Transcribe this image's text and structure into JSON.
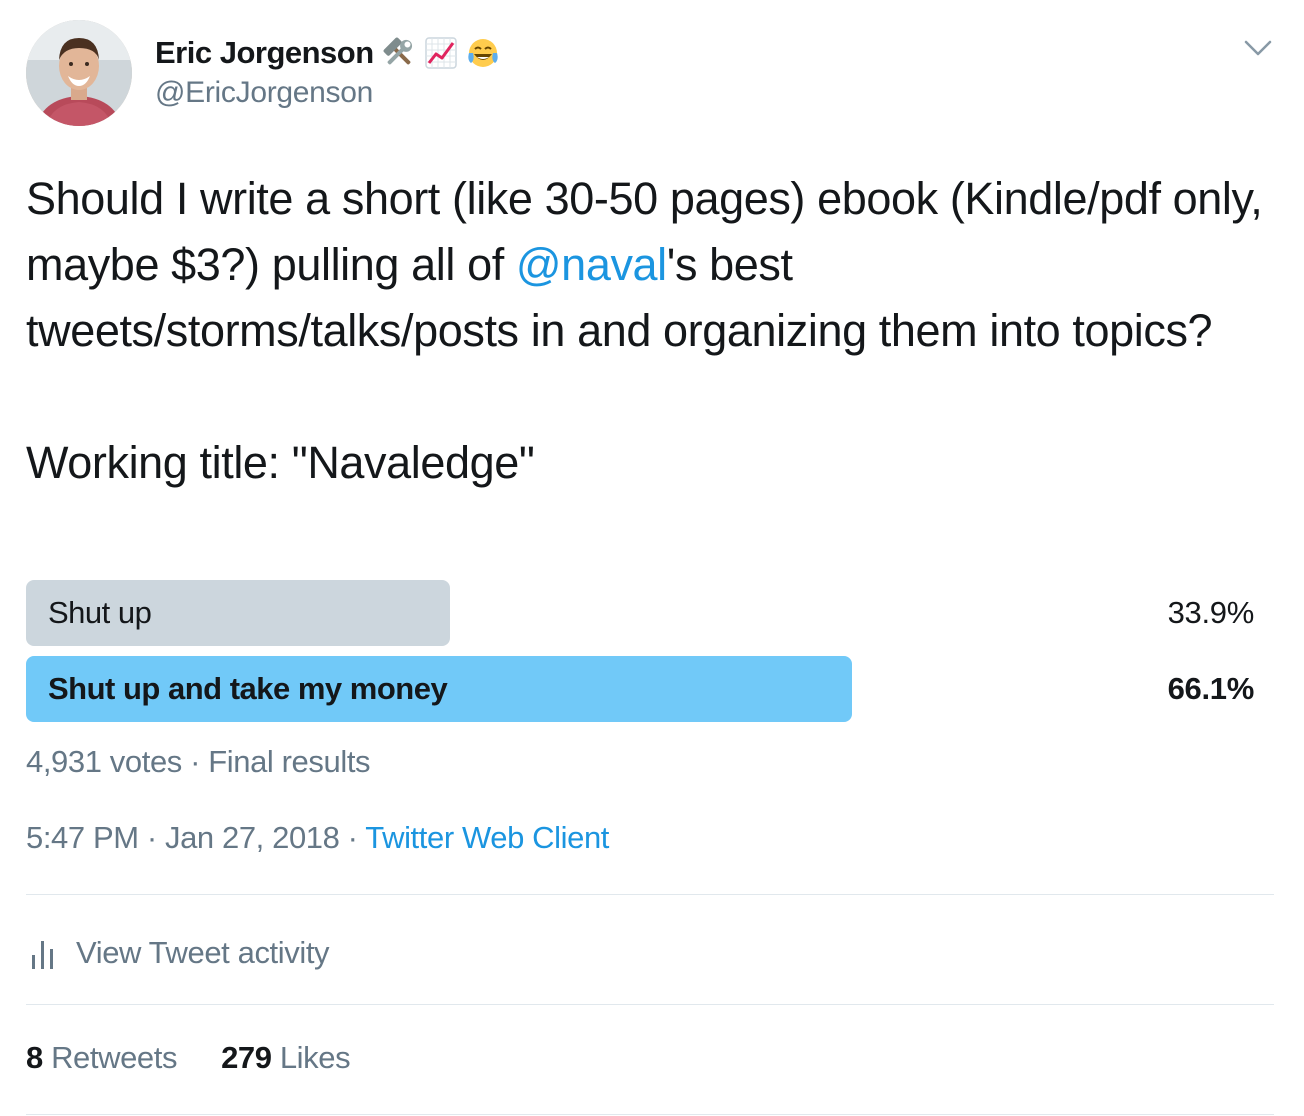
{
  "author": {
    "display_name": "Eric Jorgenson",
    "handle": "@EricJorgenson",
    "badge_icons": [
      "hammer-and-wrench-icon",
      "chart-increasing-icon",
      "face-with-tears-of-joy-icon"
    ]
  },
  "tweet": {
    "line1_before": "Should I write a short (like 30-50 pages) ebook (Kindle/pdf only, maybe $3?) pulling all of ",
    "mention": "@naval",
    "line1_after": "'s best tweets/storms/talks/posts in and organizing them into topics?",
    "working_title": "Working title: \"Navaledge\""
  },
  "poll": {
    "options": [
      {
        "label": "Shut up",
        "percent_text": "33.9%",
        "fraction": 0.339,
        "winner": false
      },
      {
        "label": "Shut up and take my money",
        "percent_text": "66.1%",
        "fraction": 0.661,
        "winner": true
      }
    ],
    "meta": "4,931 votes · Final results"
  },
  "details": {
    "time": "5:47 PM · Jan 27, 2018 · ",
    "client": "Twitter Web Client",
    "activity_label": "View Tweet activity"
  },
  "stats": {
    "retweets_count": "8",
    "retweets_label": "Retweets",
    "likes_count": "279",
    "likes_label": "Likes"
  },
  "colors": {
    "accent": "#1b95e0",
    "poll_loser": "#ccd6dd",
    "poll_winner": "#71c9f8",
    "muted_text": "#657786"
  }
}
